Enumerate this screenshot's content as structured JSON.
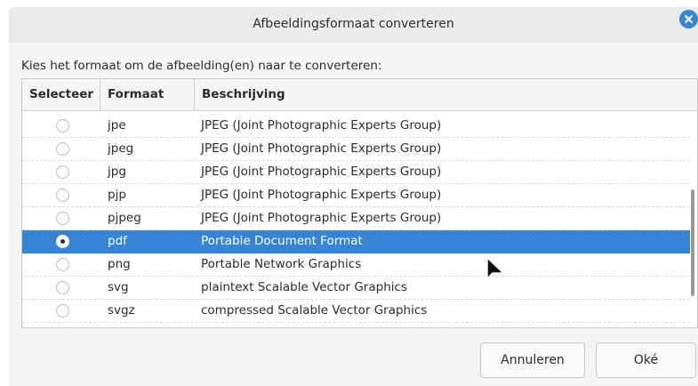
{
  "dialog": {
    "title": "Afbeeldingsformaat converteren",
    "prompt": "Kies het formaat om de afbeelding(en) naar te converteren:"
  },
  "table": {
    "headers": {
      "select": "Selecteer",
      "format": "Formaat",
      "description": "Beschrijving"
    },
    "rows": [
      {
        "format": "jpe",
        "description": "JPEG (Joint Photographic Experts Group)",
        "selected": false
      },
      {
        "format": "jpeg",
        "description": "JPEG (Joint Photographic Experts Group)",
        "selected": false
      },
      {
        "format": "jpg",
        "description": "JPEG (Joint Photographic Experts Group)",
        "selected": false
      },
      {
        "format": "pjp",
        "description": "JPEG (Joint Photographic Experts Group)",
        "selected": false
      },
      {
        "format": "pjpeg",
        "description": "JPEG (Joint Photographic Experts Group)",
        "selected": false
      },
      {
        "format": "pdf",
        "description": "Portable Document Format",
        "selected": true
      },
      {
        "format": "png",
        "description": "Portable Network Graphics",
        "selected": false
      },
      {
        "format": "svg",
        "description": "plaintext Scalable Vector Graphics",
        "selected": false
      },
      {
        "format": "svgz",
        "description": "compressed Scalable Vector Graphics",
        "selected": false
      }
    ]
  },
  "buttons": {
    "cancel": "Annuleren",
    "ok": "Oké"
  },
  "colors": {
    "selection": "#3584d6",
    "close_button": "#3585d8"
  },
  "icons": {
    "close": "close-icon",
    "cursor": "mouse-pointer-icon"
  }
}
